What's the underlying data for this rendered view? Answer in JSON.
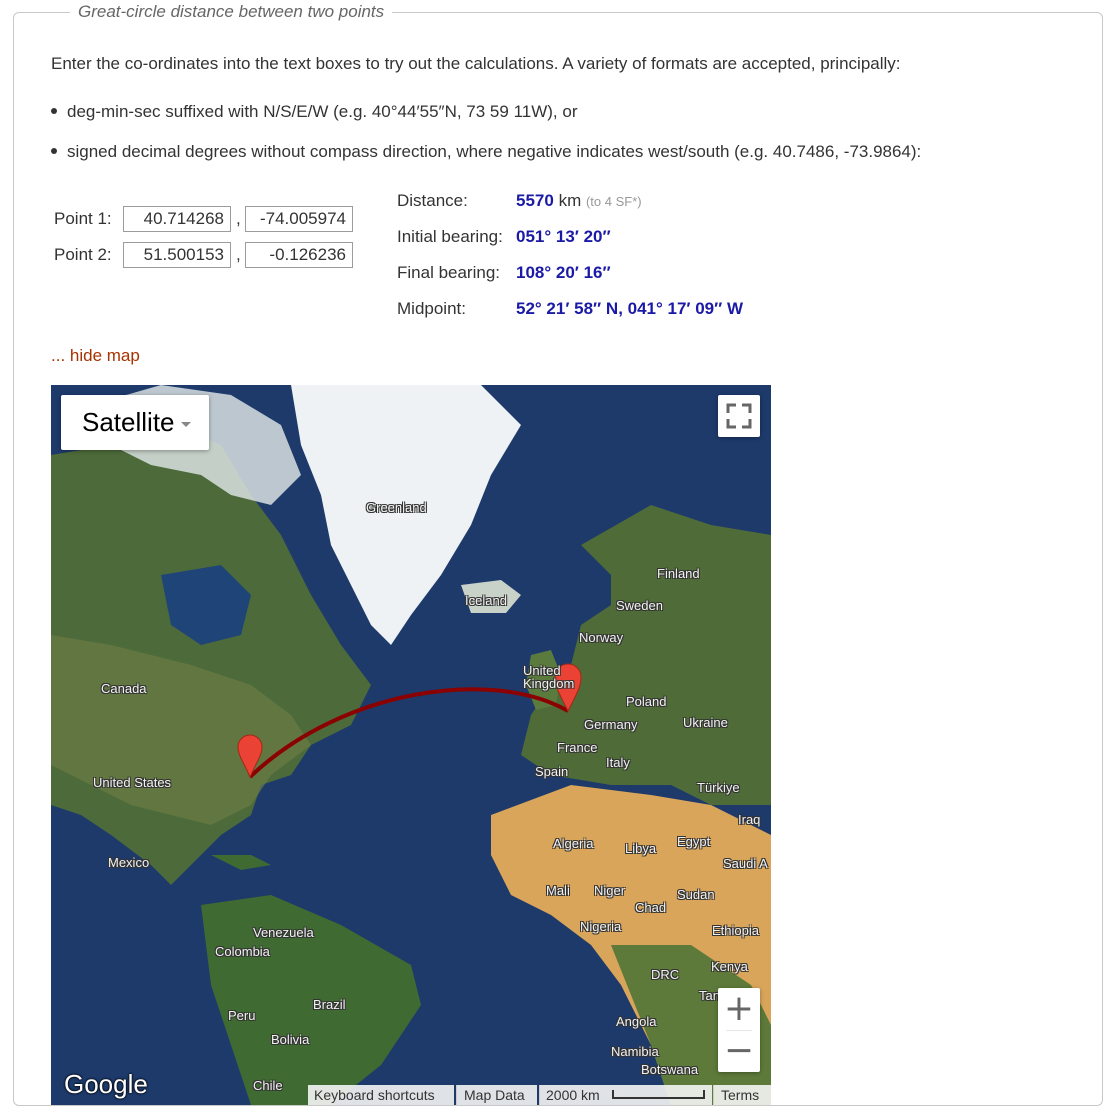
{
  "legend": "Great-circle distance between two points",
  "intro": "Enter the co-ordinates into the text boxes to try out the calculations. A variety of formats are accepted, principally:",
  "bullets": [
    "deg-min-sec suffixed with N/S/E/W (e.g. 40°44′55″N, 73 59 11W), or",
    "signed decimal degrees without compass direction, where negative indicates west/south (e.g. 40.7486, -73.9864):"
  ],
  "points": {
    "p1": {
      "label": "Point 1:",
      "lat": "40.714268",
      "lon": "-74.005974"
    },
    "p2": {
      "label": "Point 2:",
      "lat": "51.500153",
      "lon": "-0.126236"
    },
    "sep": ","
  },
  "results": {
    "distance": {
      "label": "Distance:",
      "value": "5570",
      "unit": "km",
      "note": "(to 4 SF*)"
    },
    "initial_bearing": {
      "label": "Initial bearing:",
      "value": "051° 13′ 20″"
    },
    "final_bearing": {
      "label": "Final bearing:",
      "value": "108° 20′ 16″"
    },
    "midpoint": {
      "label": "Midpoint:",
      "value": "52° 21′ 58″ N, 041° 17′ 09″ W"
    }
  },
  "hide_map": "... hide map",
  "map": {
    "map_type": "Satellite",
    "labels": {
      "greenland": "Greenland",
      "iceland": "Iceland",
      "finland": "Finland",
      "sweden": "Sweden",
      "norway": "Norway",
      "uk": "United Kingdom",
      "poland": "Poland",
      "germany": "Germany",
      "ukraine": "Ukraine",
      "france": "France",
      "italy": "Italy",
      "spain": "Spain",
      "turkiye": "Türkiye",
      "iraq": "Iraq",
      "canada": "Canada",
      "united_states": "United States",
      "mexico": "Mexico",
      "algeria": "Algeria",
      "libya": "Libya",
      "egypt": "Egypt",
      "saudi": "Saudi A",
      "mali": "Mali",
      "niger": "Niger",
      "sudan": "Sudan",
      "chad": "Chad",
      "nigeria": "Nigeria",
      "ethiopia": "Ethiopia",
      "venezuela": "Venezuela",
      "colombia": "Colombia",
      "drc": "DRC",
      "kenya": "Kenya",
      "tanzania": "Tan",
      "brazil": "Brazil",
      "peru": "Peru",
      "bolivia": "Bolivia",
      "angola": "Angola",
      "namibia": "Namibia",
      "botswana": "Botswana",
      "chile": "Chile"
    },
    "google": "Google",
    "attribution": {
      "keyboard": "Keyboard shortcuts",
      "map_data": "Map Data",
      "scale": "2000 km",
      "terms": "Terms"
    },
    "zoom_in": "+",
    "zoom_out": "−",
    "colors": {
      "ocean": "#1d3a6b",
      "land": "#4d6b3a",
      "desert": "#d9a55a",
      "ice": "#eef2f4",
      "route": "#8b0000",
      "marker": "#ea4335"
    }
  }
}
